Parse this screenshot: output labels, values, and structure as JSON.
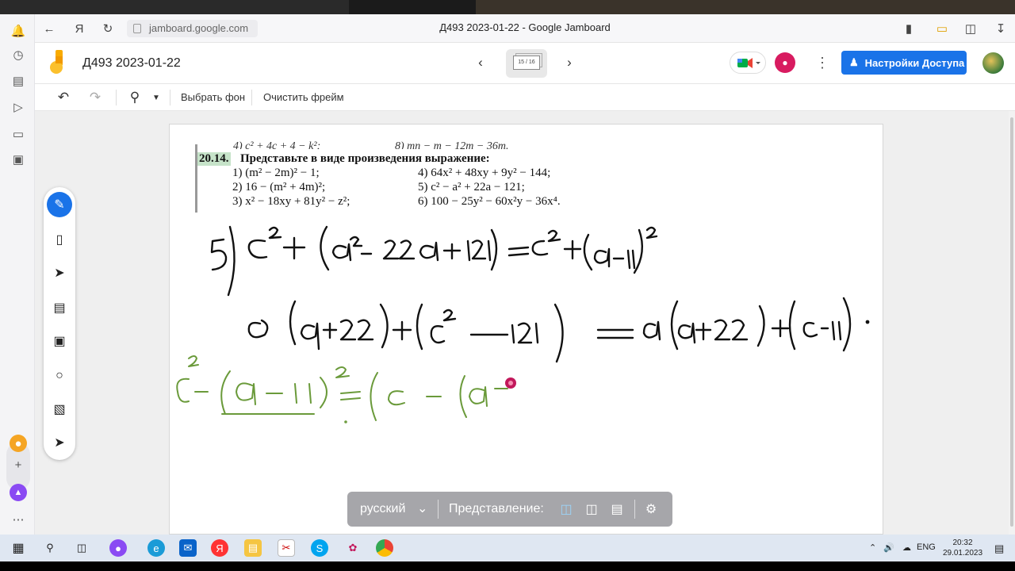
{
  "browser": {
    "url": "jamboard.google.com",
    "tab_title": "Д493 2023-01-22 - Google Jamboard"
  },
  "app": {
    "doc_title": "Д493 2023-01-22",
    "frame_indicator": "15 / 16",
    "share_label": "Настройки Доступа"
  },
  "toolbar": {
    "set_background": "Выбрать фон",
    "clear_frame": "Очистить фрейм"
  },
  "textbook": {
    "cut_line_left": "4) c² + 4c + 4 − k²;",
    "cut_line_right": "8) mn − m − 12m − 36m.",
    "problem_number": "20.14.",
    "problem_text": "Представьте в виде произведения выражение:",
    "items": [
      "1) (m² − 2m)² − 1;",
      "2) 16 − (m² + 4m)²;",
      "3) x² − 18xy + 81y² − z²;",
      "4) 64x² + 48xy + 9y² − 144;",
      "5) c² − a² + 22a − 121;",
      "6) 100 − 25y² − 60x²y − 36x⁴."
    ]
  },
  "presenter": {
    "language": "русский",
    "view_label": "Представление:"
  },
  "taskbar": {
    "lang": "ENG",
    "time": "20:32",
    "date": "29.01.2023"
  },
  "colors": {
    "accent": "#1a73e8",
    "ink_black": "#111111",
    "ink_green": "#6a9a3a",
    "pen_pink": "#c2185b"
  }
}
